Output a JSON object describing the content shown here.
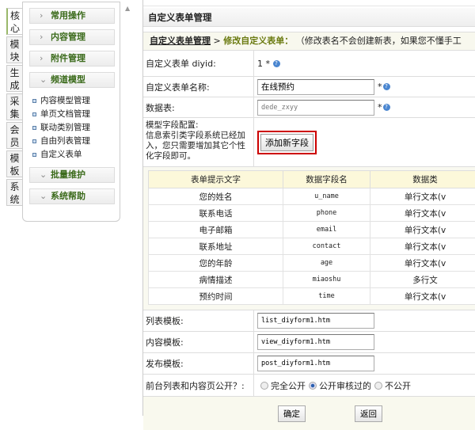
{
  "vtabs": [
    "核心",
    "模块",
    "生成",
    "采集",
    "会员",
    "模板",
    "系统"
  ],
  "sidebar": {
    "groups_top": [
      "常用操作",
      "内容管理",
      "附件管理"
    ],
    "open_group": "频道模型",
    "items": [
      "内容模型管理",
      "单页文档管理",
      "联动类别管理",
      "自由列表管理",
      "自定义表单"
    ],
    "groups_bottom": [
      "批量维护",
      "系统帮助"
    ]
  },
  "main": {
    "title": "自定义表单管理",
    "crumb": {
      "link": "自定义表单管理",
      "sep": " > ",
      "current": "修改自定义表单：",
      "note": "（修改表名不会创建新表，如果您不懂手工"
    },
    "diyid": {
      "label": "自定义表单 diyid:",
      "value": "1 *"
    },
    "name": {
      "label": "自定义表单名称:",
      "value": "在线预约"
    },
    "table": {
      "label": "数据表:",
      "value": "dede_zxyy"
    },
    "config": {
      "label1": "模型字段配置:",
      "label2": "信息索引类字段系统已经加入，您只需要增加其它个性化字段即可。",
      "button": "添加新字段"
    },
    "fields": {
      "headers": [
        "表单提示文字",
        "数据字段名",
        "数据类"
      ],
      "rows": [
        [
          "您的姓名",
          "u_name",
          "单行文本(v"
        ],
        [
          "联系电话",
          "phone",
          "单行文本(v"
        ],
        [
          "电子邮箱",
          "email",
          "单行文本(v"
        ],
        [
          "联系地址",
          "contact",
          "单行文本(v"
        ],
        [
          "您的年龄",
          "age",
          "单行文本(v"
        ],
        [
          "病情描述",
          "miaoshu",
          "多行文"
        ],
        [
          "预约时间",
          "time",
          "单行文本(v"
        ]
      ]
    },
    "list_tpl": {
      "label": "列表模板:",
      "value": "list_diyform1.htm"
    },
    "view_tpl": {
      "label": "内容模板:",
      "value": "view_diyform1.htm"
    },
    "post_tpl": {
      "label": "发布模板:",
      "value": "post_diyform1.htm"
    },
    "public": {
      "label": "前台列表和内容页公开？:",
      "options": [
        "完全公开",
        "公开审核过的",
        "不公开"
      ],
      "selected": "公开审核过的"
    },
    "ok": "确定",
    "back": "返回"
  },
  "colors": {
    "highlight": "#cc0000",
    "group_text": "#3a6a1a"
  }
}
